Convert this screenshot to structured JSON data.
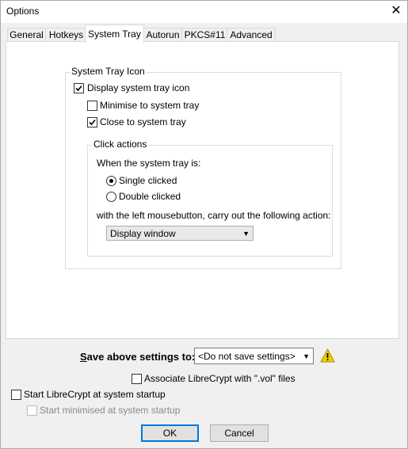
{
  "window": {
    "title": "Options"
  },
  "tabs": [
    {
      "label": "General"
    },
    {
      "label": "Hotkeys"
    },
    {
      "label": "System Tray"
    },
    {
      "label": "Autorun"
    },
    {
      "label": "PKCS#11"
    },
    {
      "label": "Advanced"
    }
  ],
  "tray_group": {
    "legend": "System Tray Icon",
    "display_icon": {
      "label": "Display system tray icon",
      "checked": true
    },
    "minimise": {
      "label": "Minimise to system tray",
      "checked": false
    },
    "close": {
      "label": "Close to system tray",
      "checked": true
    }
  },
  "click_group": {
    "legend": "Click actions",
    "prompt": "When the system tray is:",
    "single": {
      "label": "Single clicked",
      "selected": true
    },
    "double": {
      "label": "Double clicked",
      "selected": false
    },
    "action_prompt": "with the left mousebutton, carry out the following action:",
    "action_value": "Display window"
  },
  "save": {
    "label": "Save above settings to:",
    "value": "<Do not save settings>"
  },
  "associate": {
    "label": "Associate LibreCrypt with \".vol\" files",
    "checked": false
  },
  "startup": {
    "label": "Start LibreCrypt at system startup",
    "checked": false
  },
  "start_minimised": {
    "label": "Start minimised at system startup",
    "checked": false,
    "enabled": false
  },
  "buttons": {
    "ok": "OK",
    "cancel": "Cancel"
  },
  "colors": {
    "accent": "#0078d7",
    "warning": "#f5d000"
  }
}
